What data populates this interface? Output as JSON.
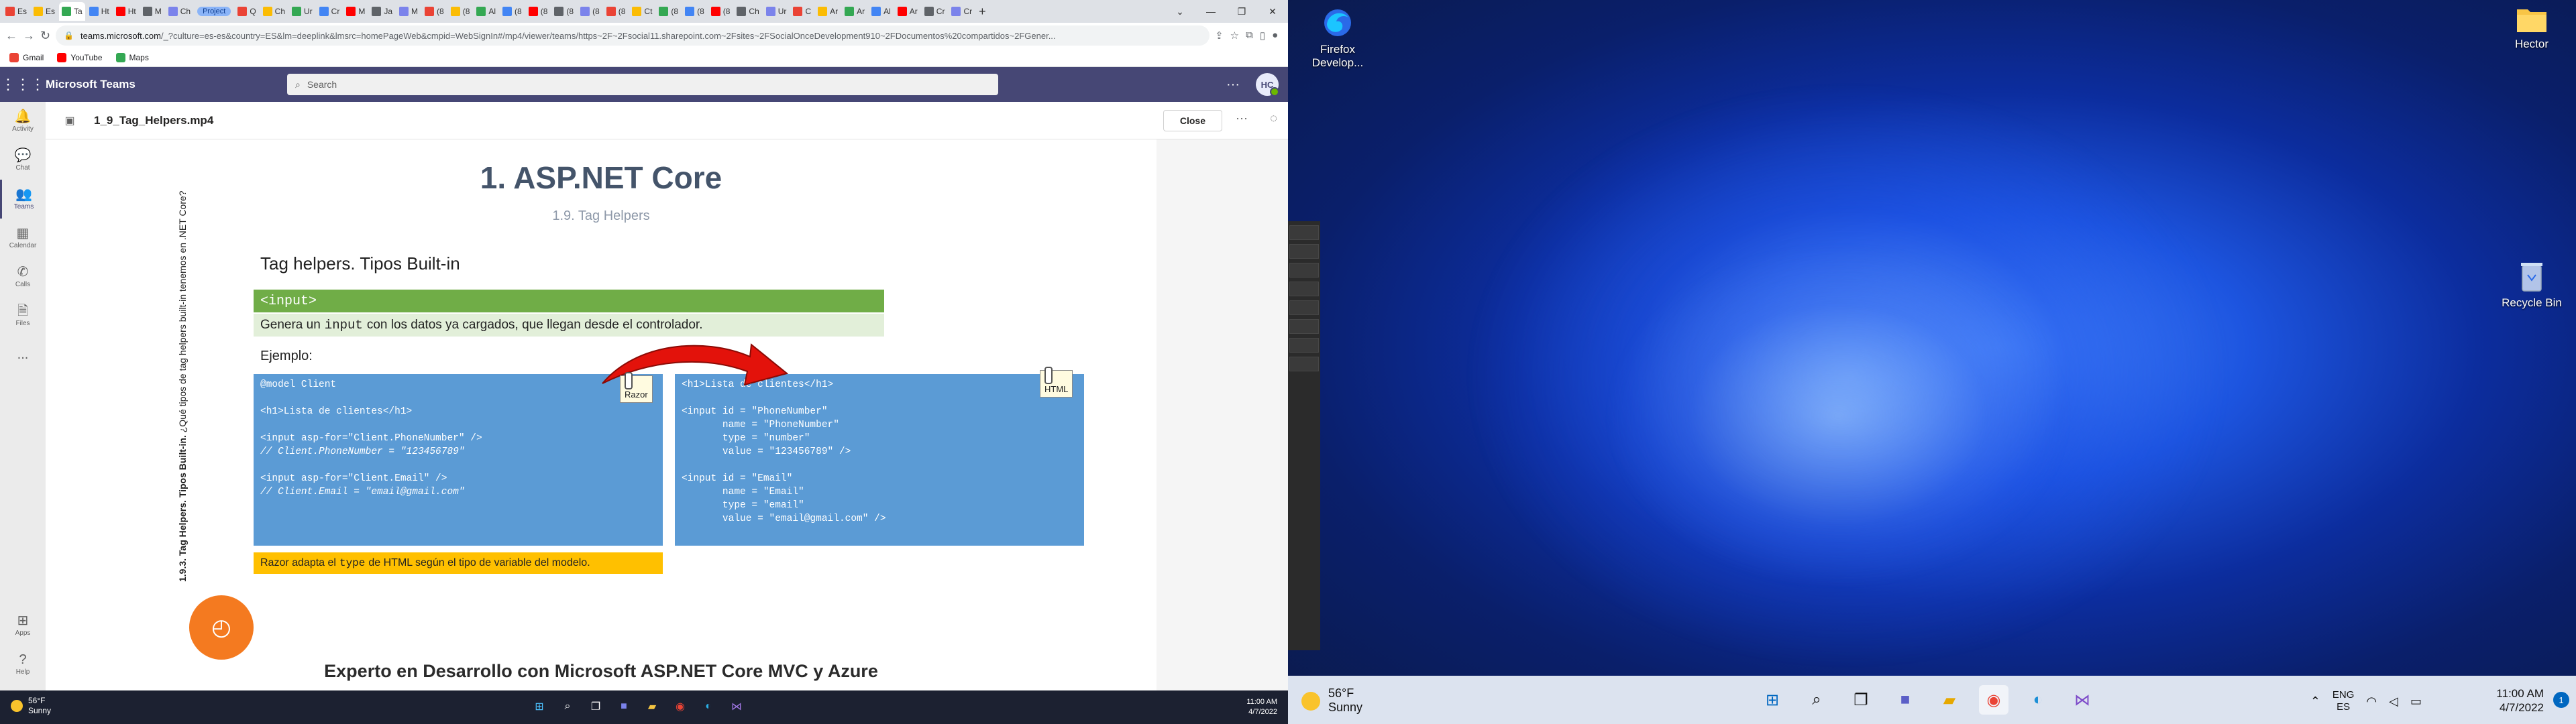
{
  "browser": {
    "tab_group": "Project",
    "tabs": [
      "Es",
      "Es",
      "Ta",
      "Ht",
      "Ht",
      "M",
      "Ch",
      "Q",
      "Ch",
      "Ur",
      "Cr",
      "M",
      "Ja",
      "M",
      "(8",
      "(8",
      "Al",
      "(8",
      "(8",
      "(8",
      "(8",
      "(8",
      "Ct",
      "(8",
      "(8",
      "(8",
      "Ch",
      "Ur",
      "C",
      "Ar",
      "Ar",
      "Al",
      "Ar",
      "Cr",
      "Cr"
    ],
    "url_host": "teams.microsoft.com",
    "url_path": "/_?culture=es-es&country=ES&lm=deeplink&lmsrc=homePageWeb&cmpid=WebSignIn#/mp4/viewer/teams/https~2F~2Fsocial11.sharepoint.com~2Fsites~2FSocialOnceDevelopment910~2FDocumentos%20compartidos~2FGener...",
    "bookmarks": [
      "Gmail",
      "YouTube",
      "Maps"
    ]
  },
  "teams": {
    "app_name": "Microsoft Teams",
    "search_placeholder": "Search",
    "avatar_initials": "HC",
    "rail": [
      {
        "label": "Activity",
        "icon": "bell-icon"
      },
      {
        "label": "Chat",
        "icon": "chat-icon"
      },
      {
        "label": "Teams",
        "icon": "teams-icon"
      },
      {
        "label": "Calendar",
        "icon": "calendar-icon"
      },
      {
        "label": "Calls",
        "icon": "phone-icon"
      },
      {
        "label": "Files",
        "icon": "file-icon"
      }
    ],
    "rail_more": "...",
    "rail_apps": "Apps",
    "rail_help": "Help",
    "file_name": "1_9_Tag_Helpers.mp4",
    "close_label": "Close"
  },
  "slide": {
    "title": "1. ASP.NET Core",
    "subtitle": "1.9. Tag Helpers",
    "vertical_bold": "1.9.3. Tag Helpers. Tipos Built-in.",
    "vertical_rest": " ¿Qué tipos de tag helpers built-in tenemos en .NET Core?",
    "section_title": "Tag helpers. Tipos Built-in",
    "input_tag": "<input>",
    "desc_pre": "Genera un",
    "desc_code": "input",
    "desc_post": "con los datos ya cargados, que llegan desde el controlador.",
    "example_label": "Ejemplo:",
    "razor_code": [
      {
        "t": "@model Client",
        "c": false
      },
      {
        "t": "",
        "c": false
      },
      {
        "t": "<h1>Lista de clientes</h1>",
        "c": false
      },
      {
        "t": "",
        "c": false
      },
      {
        "t": "<input asp-for=\"Client.PhoneNumber\" />",
        "c": false
      },
      {
        "t": "// Client.PhoneNumber = \"123456789\"",
        "c": true
      },
      {
        "t": "",
        "c": false
      },
      {
        "t": "<input asp-for=\"Client.Email\" />",
        "c": false
      },
      {
        "t": "// Client.Email = \"email@gmail.com\"",
        "c": true
      }
    ],
    "html_code": [
      "<h1>Lista de clientes</h1>",
      "",
      "<input id = \"PhoneNumber\"",
      "       name = \"PhoneNumber\"",
      "       type = \"number\"",
      "       value = \"123456789\" />",
      "",
      "<input id = \"Email\"",
      "       name = \"Email\"",
      "       type = \"email\"",
      "       value = \"email@gmail.com\" />"
    ],
    "razor_tag": "Razor",
    "html_tag": "HTML",
    "note_pre": "Razor adapta el",
    "note_code": "type",
    "note_post": "de HTML según el tipo de variable del modelo.",
    "footer": "Experto en Desarrollo con Microsoft ASP.NET Core MVC y Azure"
  },
  "taskbar_left": {
    "temp": "56°F",
    "condition": "Sunny",
    "time": "11:00 AM",
    "date": "4/7/2022"
  },
  "desktop": {
    "icons": [
      {
        "label": "Firefox Develop...",
        "icon": "firefox-icon"
      },
      {
        "label": "Hector",
        "icon": "folder-icon"
      },
      {
        "label": "Recycle Bin",
        "icon": "recycle-bin-icon"
      }
    ],
    "taskbar": {
      "temp": "56°F",
      "condition": "Sunny",
      "lang_1": "ENG",
      "lang_2": "ES",
      "time": "11:00 AM",
      "date": "4/7/2022",
      "notifications": "1"
    }
  }
}
